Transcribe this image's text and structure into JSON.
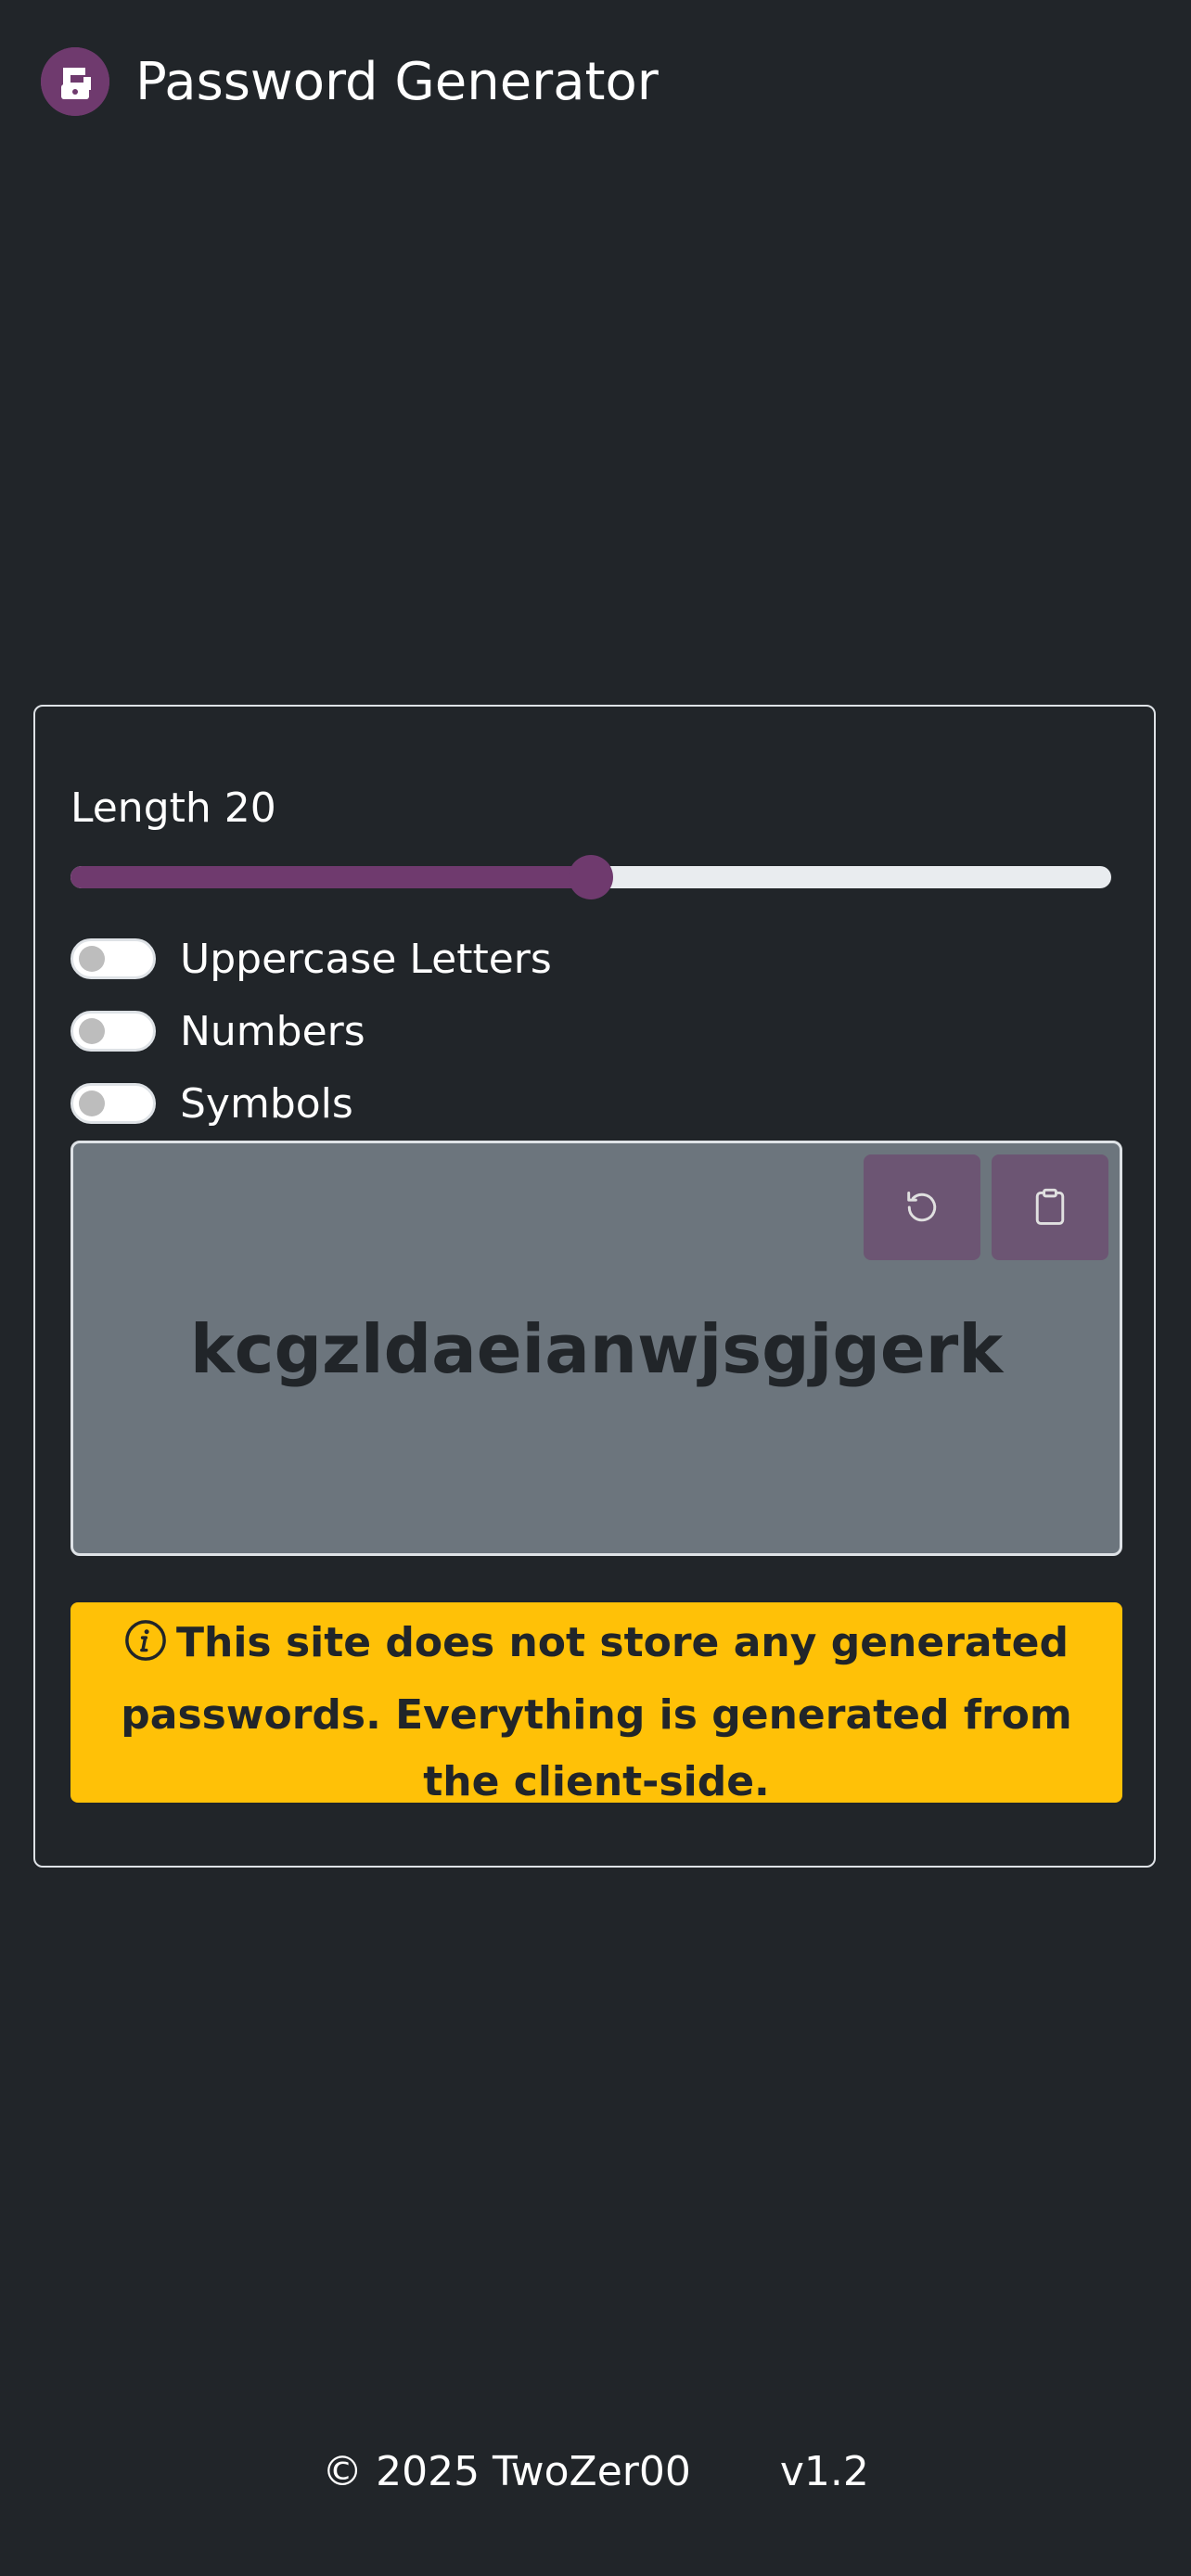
{
  "header": {
    "title": "Password Generator",
    "logo_icon": "padlock-g-icon",
    "accent_color": "#6f3a6e"
  },
  "generator": {
    "length_label": "Length",
    "length_value": "20",
    "slider_fraction": 0.5,
    "options": [
      {
        "label": "Uppercase Letters",
        "enabled": false
      },
      {
        "label": "Numbers",
        "enabled": false
      },
      {
        "label": "Symbols",
        "enabled": false
      }
    ],
    "password": "kcgzldaeianwjsgjgerk",
    "buttons": {
      "regenerate_icon": "refresh-icon",
      "copy_icon": "clipboard-icon"
    },
    "notice": "This site does not store any generated passwords. Everything is generated from the client-side.",
    "notice_color": "#ffc107"
  },
  "footer": {
    "copyright": "© 2025 TwoZer00",
    "version": "v1.2"
  }
}
